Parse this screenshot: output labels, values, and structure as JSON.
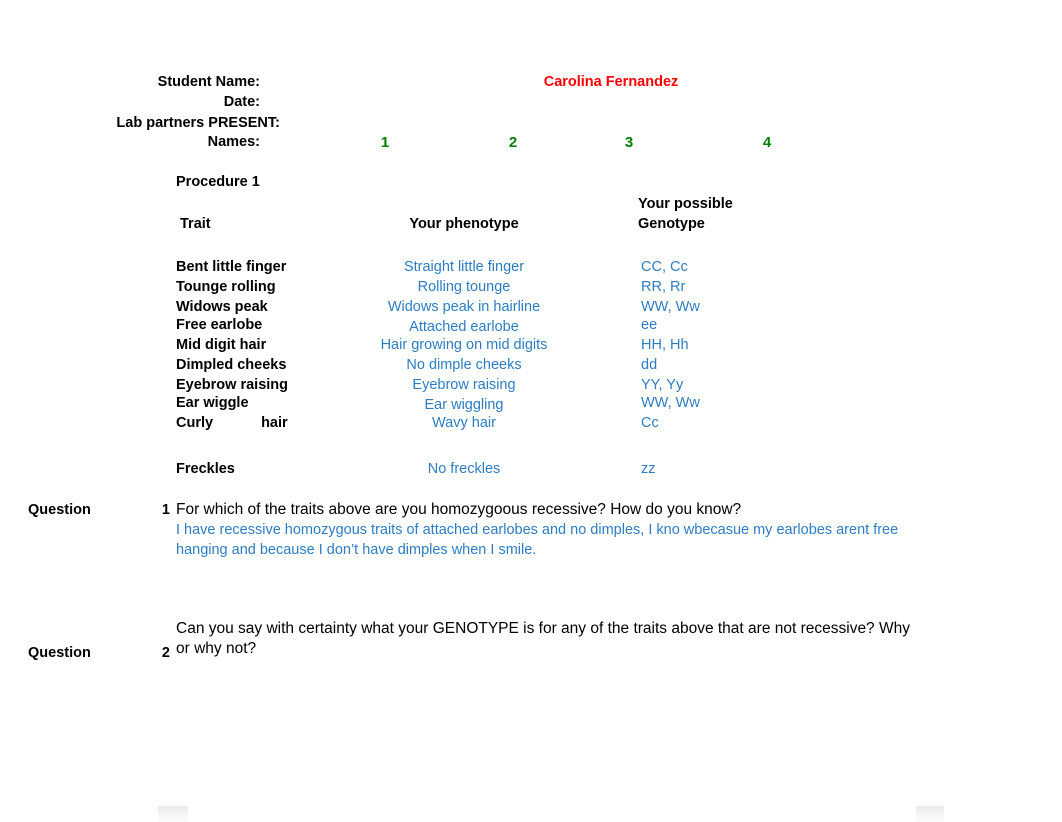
{
  "header": {
    "student_name_label": "Student Name:",
    "date_label": "Date:",
    "lab_partners_label": "Lab partners PRESENT:",
    "names_label": "Names:",
    "student_name_value": "Carolina Fernandez",
    "partner_numbers": [
      "1",
      "2",
      "3",
      "4"
    ],
    "colors": {
      "student_name": "#FF0000",
      "partner_number": "#008000"
    }
  },
  "procedure": {
    "title": "Procedure 1",
    "columns": {
      "trait": "Trait",
      "phenotype": "Your phenotype",
      "genotype_line1": "Your possible",
      "genotype_line2": "Genotype"
    },
    "answer_color": "#2E7DC2",
    "rows": [
      {
        "trait": "Bent little finger",
        "phenotype": "Straight little finger",
        "genotype": "CC, Cc"
      },
      {
        "trait": "Tounge rolling",
        "phenotype": "Rolling tounge",
        "genotype": "RR, Rr"
      },
      {
        "trait": "Widows peak",
        "phenotype": "Widows peak in hairline",
        "genotype": "WW, Ww"
      },
      {
        "trait": "Free earlobe",
        "phenotype": "Attached earlobe",
        "genotype": "ee"
      },
      {
        "trait": "Mid digit hair",
        "phenotype": "Hair growing on mid digits",
        "genotype": "HH, Hh"
      },
      {
        "trait": "Dimpled cheeks",
        "phenotype": "No dimple cheeks",
        "genotype": "dd"
      },
      {
        "trait": "Eyebrow raising",
        "phenotype": "Eyebrow raising",
        "genotype": "YY, Yy"
      },
      {
        "trait": "Ear wiggle",
        "phenotype": "Ear wiggling",
        "genotype": "WW, Ww"
      },
      {
        "trait_part1": "Curly",
        "trait_part2": "hair",
        "phenotype": "Wavy hair",
        "genotype": "Cc"
      },
      {
        "trait": "Freckles",
        "phenotype": "No freckles",
        "genotype": "zz"
      }
    ]
  },
  "questions": [
    {
      "label": "Question",
      "number": "1",
      "text": "For which of the traits above are you homozygoous recessive? How do you know?",
      "answer": "I have recessive homozygous traits of attached earlobes and no dimples, I kno wbecasue my earlobes arent free hanging and because I don’t have dimples when I smile."
    },
    {
      "label": "Question",
      "number": "2",
      "text": "Can you say with certainty what your GENOTYPE is for any of the traits above that are not recessive? Why or why not?",
      "answer": ""
    }
  ]
}
